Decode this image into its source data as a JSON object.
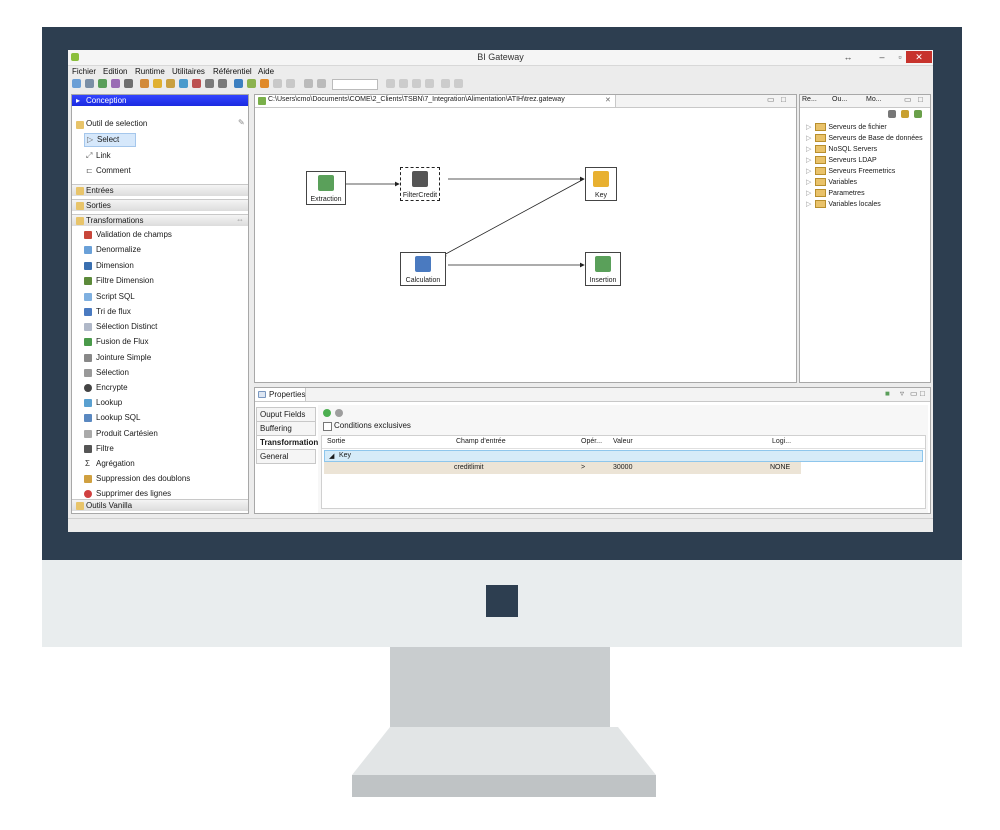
{
  "window": {
    "title": "BI Gateway",
    "minimize": "–",
    "maximize": "▫",
    "close": "✕",
    "extra": "↔"
  },
  "menu": [
    "Fichier",
    "Edition",
    "Runtime",
    "Utilitaires",
    "Référentiel",
    "Aide"
  ],
  "palette": {
    "header": "Conception",
    "tools_category": "Outil de selection",
    "tools": [
      "Select",
      "Link",
      "Comment"
    ],
    "categories": [
      "Entrées",
      "Sorties",
      "Transformations"
    ],
    "transformations": [
      "Validation de champs",
      "Denormalize",
      "Dimension",
      "Filtre Dimension",
      "Script SQL",
      "Tri de flux",
      "Sélection Distinct",
      "Fusion de Flux",
      "Jointure Simple",
      "Sélection",
      "Encrypte",
      "Lookup",
      "Lookup SQL",
      "Produit Cartésien",
      "Filtre",
      "Agrégation",
      "Suppression des doublons",
      "Supprimer des lignes"
    ],
    "last_category": "Outils Vanilla"
  },
  "editor": {
    "tab": "C:\\Users\\cmo\\Documents\\COME\\2_Clients\\TSBN\\7_Integration\\Alimentation\\ATIH\\trez.gateway",
    "nodes": {
      "extraction": "Extraction",
      "filter": "FilterCredit",
      "key": "Key",
      "calc": "Calculation",
      "insert": "Insertion"
    }
  },
  "right": {
    "tabs": [
      "Re...",
      "Ou...",
      "Mo..."
    ],
    "tree": [
      "Serveurs de fichier",
      "Serveurs de Base de données",
      "NoSQL Servers",
      "Serveurs LDAP",
      "Serveurs Freemetrics",
      "Variables",
      "Parametres",
      "Variables locales"
    ]
  },
  "properties": {
    "title": "Properties",
    "tabs": [
      "Ouput Fields",
      "Buffering",
      "Transformation",
      "General"
    ],
    "checkbox": "Conditions exclusives",
    "columns": [
      "Sortie",
      "Champ d'entrée",
      "Opér...",
      "Valeur",
      "Logi..."
    ],
    "group": "Key",
    "row": {
      "champ": "creditlimit",
      "op": ">",
      "valeur": "30000",
      "logique": "NONE"
    }
  }
}
